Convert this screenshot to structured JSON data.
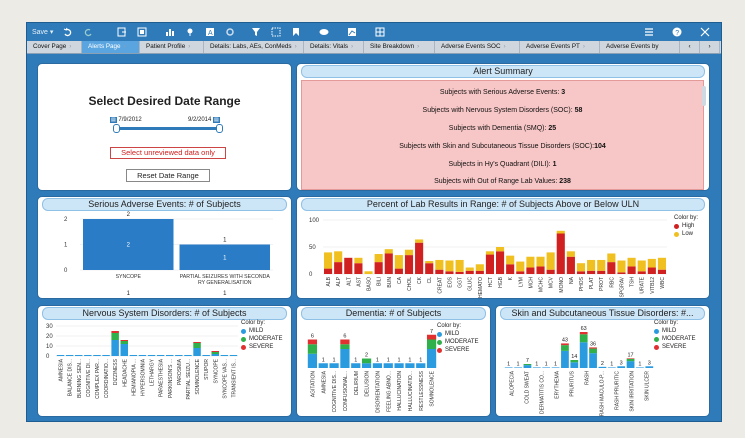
{
  "toolbar": {
    "save": "Save ▾",
    "icons": [
      "undo-icon",
      "redo-icon",
      "export-icon",
      "import-icon",
      "bar-chart-icon",
      "pin-icon",
      "text-icon",
      "gear-icon",
      "filter-icon",
      "select-icon",
      "bookmark-icon",
      "eye-icon",
      "chart-type-icon",
      "layout-icon",
      "menu-icon",
      "help-icon",
      "close-icon"
    ]
  },
  "tabs": [
    {
      "label": "Cover Page"
    },
    {
      "label": "Alerts Page"
    },
    {
      "label": "Patient Profile"
    },
    {
      "label": "Details: Labs, AEs, ConMeds"
    },
    {
      "label": "Details: Vitals"
    },
    {
      "label": "Site Breakdown"
    },
    {
      "label": "Adverse Events SOC"
    },
    {
      "label": "Adverse Events PT"
    },
    {
      "label": "Adverse Events by"
    }
  ],
  "date_range": {
    "title": "Select Desired Date Range",
    "start": "7/9/2012",
    "end": "9/2/2014",
    "unreviewed_label": "Select unreviewed data only",
    "reset_label": "Reset Date Range"
  },
  "alert_summary": {
    "title": "Alert Summary",
    "lines": [
      {
        "text": "Subjects with Serious Adverse Events:",
        "value": "3"
      },
      {
        "text": "Subjects with Nervous System Disorders (SOC):",
        "value": "58"
      },
      {
        "text": "Subjects with Dementia (SMQ):",
        "value": "25"
      },
      {
        "text": "Subjects with Skin and Subcutaneous Tissue Disorders (SOC):",
        "value": "104"
      },
      {
        "text": "Subjects in Hy's Quadrant (DILI):",
        "value": "1"
      },
      {
        "text": "Subjects with Out of Range Lab Values:",
        "value": "238"
      }
    ]
  },
  "colors": {
    "bar_blue": "#2b7cc7",
    "high": "#d02020",
    "low": "#f0c020",
    "mild": "#2b9be0",
    "moderate": "#2fb04a",
    "severe": "#e23030"
  },
  "chart_data": [
    {
      "type": "bar",
      "title": "Serious Adverse Events: # of Subjects",
      "categories": [
        "SYNCOPE",
        "PARTIAL SEIZURES WITH SECONDARY GENERALISATION"
      ],
      "values": [
        2,
        1
      ],
      "ylim": [
        0,
        2
      ],
      "yticks": [
        "0",
        "1",
        "2"
      ],
      "below_labels": [
        "1",
        "1"
      ]
    },
    {
      "type": "bar",
      "title": "Percent of Lab Results in Range: # of Subjects Above or Below ULN",
      "legend_title": "Color by:",
      "categories": [
        "ALB",
        "ALP",
        "ALT",
        "AST",
        "BASO",
        "BILI",
        "BUN",
        "CA",
        "CHOL",
        "CK",
        "CL",
        "CREAT",
        "EOS",
        "GGT",
        "GLUC",
        "HEMATO",
        "HCT",
        "HGB",
        "K",
        "LYM",
        "MCH",
        "MCHC",
        "MCV",
        "MONO",
        "NA",
        "PHOS",
        "PLAT",
        "PROT",
        "RBC",
        "SPGRAV",
        "TSH",
        "URATE",
        "VITB12",
        "WBC"
      ],
      "series": [
        {
          "name": "High",
          "values": [
            10,
            22,
            30,
            20,
            0,
            22,
            38,
            10,
            35,
            58,
            20,
            8,
            5,
            4,
            6,
            6,
            36,
            42,
            18,
            5,
            12,
            14,
            8,
            75,
            32,
            5,
            6,
            6,
            22,
            3,
            14,
            5,
            12,
            8
          ]
        },
        {
          "name": "Low",
          "values": [
            30,
            20,
            0,
            10,
            5,
            15,
            8,
            25,
            10,
            6,
            4,
            18,
            20,
            22,
            6,
            12,
            6,
            8,
            16,
            18,
            20,
            18,
            32,
            5,
            10,
            15,
            20,
            20,
            16,
            22,
            16,
            20,
            16,
            22
          ]
        }
      ],
      "ylim": [
        0,
        100
      ],
      "yticks": [
        "0",
        "50",
        "100"
      ]
    },
    {
      "type": "bar",
      "title": "Nervous System Disorders: # of Subjects",
      "legend_title": "Color by:",
      "categories": [
        "AMNESIA",
        "BALANCE DIS...",
        "BURNING SEN...",
        "COGNITIVE DI...",
        "COMPLEX PAR...",
        "COORDINATIO...",
        "DIZZINESS",
        "HEADACHE",
        "HEMIANOPIA ...",
        "HYPERSOMNIA",
        "LETHARGY",
        "PARAESTHESIA",
        "PARKINSON'S ...",
        "PAROSMIA",
        "PARTIAL SEIZU...",
        "SOMNOLENCE",
        "STUPOR",
        "SYNCOPE",
        "SYNCOPE VAS...",
        "TRANSIENT IS..."
      ],
      "series": [
        {
          "name": "MILD",
          "values": [
            1,
            1,
            1,
            1,
            1,
            1,
            16,
            12,
            1,
            1,
            1,
            1,
            1,
            1,
            1,
            8,
            1,
            2,
            1,
            1
          ]
        },
        {
          "name": "MODERATE",
          "values": [
            0,
            0,
            0,
            0,
            0,
            0,
            7,
            3,
            0,
            0,
            0,
            0,
            0,
            0,
            0,
            5,
            0,
            2,
            0,
            0
          ]
        },
        {
          "name": "SEVERE",
          "values": [
            0,
            0,
            0,
            0,
            0,
            0,
            2,
            1,
            0,
            0,
            0,
            0,
            0,
            0,
            0,
            1,
            0,
            1,
            0,
            0
          ]
        }
      ],
      "ylim": [
        0,
        30
      ],
      "yticks": [
        "0",
        "10",
        "20",
        "30"
      ]
    },
    {
      "type": "bar",
      "title": "Dementia: # of Subjects",
      "legend_title": "Color by:",
      "categories": [
        "AGITATION",
        "AMNESIA",
        "COGNITIVE DIS...",
        "CONFUSIONAL...",
        "DELIRIUM",
        "DELUSION",
        "DISORIENTATION",
        "FEELING ABNO...",
        "HALLUCINATION",
        "HALLUCINATIO...",
        "RESTLESSNESS",
        "SOMNOLENCE"
      ],
      "values": [
        6,
        1,
        1,
        6,
        1,
        2,
        1,
        1,
        1,
        1,
        1,
        7
      ],
      "series": [
        {
          "name": "MILD",
          "values": [
            3,
            1,
            1,
            4,
            1,
            1,
            1,
            1,
            1,
            1,
            1,
            4
          ]
        },
        {
          "name": "MODERATE",
          "values": [
            2,
            0,
            0,
            1,
            0,
            1,
            0,
            0,
            0,
            0,
            0,
            2
          ]
        },
        {
          "name": "SEVERE",
          "values": [
            1,
            0,
            0,
            1,
            0,
            0,
            0,
            0,
            0,
            0,
            0,
            1
          ]
        }
      ],
      "ylim": [
        0,
        8
      ]
    },
    {
      "type": "bar",
      "title": "Skin and Subcutaneous Tissue Disorders: #...",
      "legend_title": "Color by:",
      "categories": [
        "ALOPECIA",
        "COLD SWEAT",
        "DERMATITIS CO...",
        "ERYTHEMA",
        "PRURITUS",
        "RASH",
        "RASH MACULO-P...",
        "RASH PRURITIC",
        "SKIN IRRITATION",
        "SKIN ULCER"
      ],
      "values": [
        1,
        1,
        7,
        1,
        1,
        1,
        43,
        14,
        63,
        36,
        2,
        1,
        3,
        17,
        1,
        3
      ],
      "series": [
        {
          "name": "MILD",
          "values": [
            1,
            1,
            5,
            1,
            1,
            1,
            30,
            10,
            45,
            26,
            2,
            1,
            3,
            12,
            1,
            3
          ]
        },
        {
          "name": "MODERATE",
          "values": [
            0,
            0,
            2,
            0,
            0,
            0,
            10,
            4,
            14,
            8,
            0,
            0,
            0,
            4,
            0,
            0
          ]
        },
        {
          "name": "SEVERE",
          "values": [
            0,
            0,
            0,
            0,
            0,
            0,
            3,
            0,
            4,
            2,
            0,
            0,
            0,
            1,
            0,
            0
          ]
        }
      ],
      "ylim": [
        0,
        70
      ]
    }
  ],
  "legends": {
    "high": "High",
    "low": "Low",
    "mild": "MILD",
    "moderate": "MODERATE",
    "severe": "SEVERE",
    "color_by": "Color by:"
  }
}
